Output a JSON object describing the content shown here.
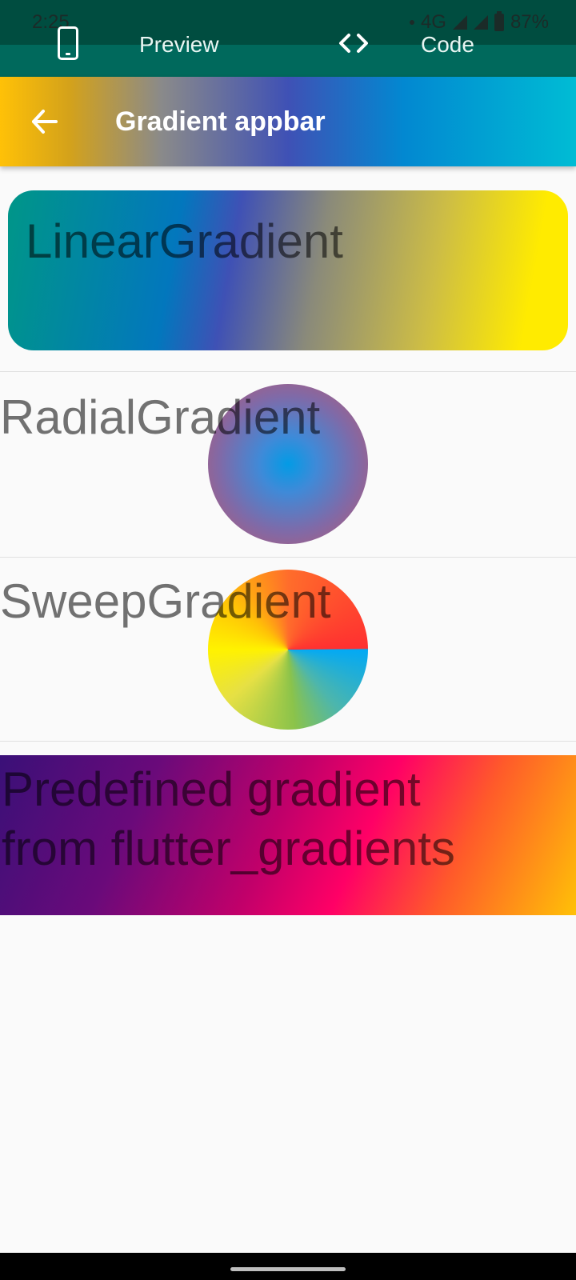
{
  "status_bar": {
    "time": "2:25",
    "network": "4G",
    "battery": "87%"
  },
  "tabs": {
    "preview_label": "Preview",
    "code_label": "Code"
  },
  "appbar": {
    "title": "Gradient appbar"
  },
  "sections": {
    "linear_label": "LinearGradient",
    "radial_label": "RadialGradient",
    "sweep_label": "SweepGradient",
    "predefined_line1": "Predefined gradient",
    "predefined_line2": "from flutter_gradients"
  },
  "colors": {
    "tab_bar": "#00695c",
    "status_strip": "#004d40",
    "background": "#fafafa"
  },
  "icons": {
    "preview": "phone-icon",
    "code": "code-icon",
    "back": "back-arrow-icon"
  }
}
